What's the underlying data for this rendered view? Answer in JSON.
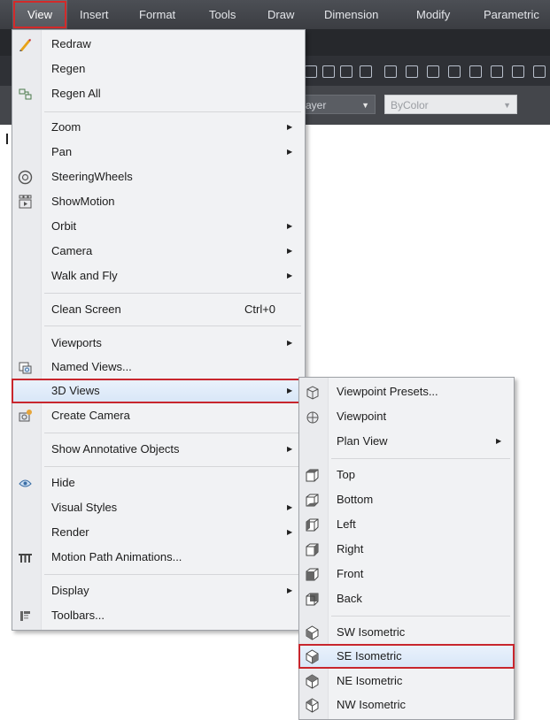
{
  "menubar": {
    "items": [
      {
        "label": "View"
      },
      {
        "label": "Insert"
      },
      {
        "label": "Format"
      },
      {
        "label": "Tools"
      },
      {
        "label": "Draw"
      },
      {
        "label": "Dimension"
      },
      {
        "label": "Modify"
      },
      {
        "label": "Parametric"
      }
    ]
  },
  "props": {
    "layer": "ayer",
    "color": "ByColor"
  },
  "view_menu": {
    "items": [
      {
        "label": "Redraw",
        "icon": "pencil-icon"
      },
      {
        "label": "Regen",
        "icon": ""
      },
      {
        "label": "Regen All",
        "icon": "regen-all-icon"
      },
      {
        "label": "Zoom",
        "submenu": true
      },
      {
        "label": "Pan",
        "submenu": true
      },
      {
        "label": "SteeringWheels",
        "icon": "steering-wheel-icon"
      },
      {
        "label": "ShowMotion",
        "icon": "showmotion-icon"
      },
      {
        "label": "Orbit",
        "submenu": true
      },
      {
        "label": "Camera",
        "submenu": true
      },
      {
        "label": "Walk and Fly",
        "submenu": true
      },
      {
        "label": "Clean Screen",
        "shortcut": "Ctrl+0"
      },
      {
        "label": "Viewports",
        "submenu": true
      },
      {
        "label": "Named Views...",
        "icon": "named-views-icon"
      },
      {
        "label": "3D Views",
        "submenu": true,
        "highlighted": true
      },
      {
        "label": "Create Camera",
        "icon": "create-camera-icon"
      },
      {
        "label": "Show Annotative Objects",
        "submenu": true
      },
      {
        "label": "Hide",
        "icon": "hide-icon"
      },
      {
        "label": "Visual Styles",
        "submenu": true
      },
      {
        "label": "Render",
        "submenu": true
      },
      {
        "label": "Motion Path Animations...",
        "icon": "motion-path-icon"
      },
      {
        "label": "Display",
        "submenu": true
      },
      {
        "label": "Toolbars...",
        "icon": "toolbars-icon"
      }
    ]
  },
  "views3d_menu": {
    "items": [
      {
        "label": "Viewpoint Presets...",
        "icon": "viewpoint-presets-icon"
      },
      {
        "label": "Viewpoint",
        "icon": "viewpoint-icon"
      },
      {
        "label": "Plan View",
        "submenu": true
      },
      {
        "label": "Top",
        "icon": "top-view-icon"
      },
      {
        "label": "Bottom",
        "icon": "bottom-view-icon"
      },
      {
        "label": "Left",
        "icon": "left-view-icon"
      },
      {
        "label": "Right",
        "icon": "right-view-icon"
      },
      {
        "label": "Front",
        "icon": "front-view-icon"
      },
      {
        "label": "Back",
        "icon": "back-view-icon"
      },
      {
        "label": "SW Isometric",
        "icon": "sw-isometric-icon"
      },
      {
        "label": "SE Isometric",
        "icon": "se-isometric-icon",
        "highlighted": true
      },
      {
        "label": "NE Isometric",
        "icon": "ne-isometric-icon"
      },
      {
        "label": "NW Isometric",
        "icon": "nw-isometric-icon"
      }
    ]
  },
  "colors": {
    "menubar_bg": "#3f4247",
    "highlight_border": "#c8262d",
    "menu_bg": "#f1f2f4"
  }
}
